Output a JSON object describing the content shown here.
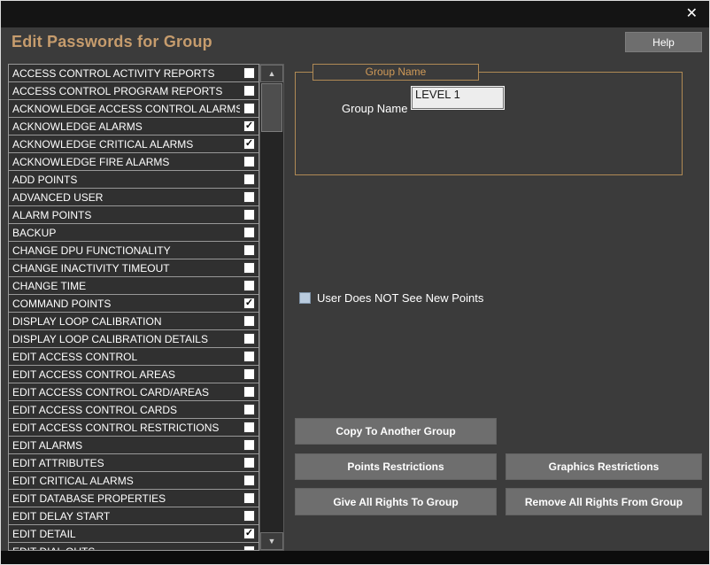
{
  "window": {
    "close_glyph": "✕"
  },
  "header": {
    "title": "Edit Passwords for Group",
    "help_label": "Help"
  },
  "permissions": {
    "checkmark_glyph": "✓",
    "items": [
      {
        "label": "ACCESS CONTROL ACTIVITY REPORTS",
        "checked": false
      },
      {
        "label": "ACCESS CONTROL PROGRAM REPORTS",
        "checked": false
      },
      {
        "label": "ACKNOWLEDGE ACCESS CONTROL ALARMS",
        "checked": false
      },
      {
        "label": "ACKNOWLEDGE ALARMS",
        "checked": true
      },
      {
        "label": "ACKNOWLEDGE CRITICAL ALARMS",
        "checked": true
      },
      {
        "label": "ACKNOWLEDGE FIRE ALARMS",
        "checked": false
      },
      {
        "label": "ADD POINTS",
        "checked": false
      },
      {
        "label": "ADVANCED USER",
        "checked": false
      },
      {
        "label": "ALARM POINTS",
        "checked": false
      },
      {
        "label": "BACKUP",
        "checked": false
      },
      {
        "label": "CHANGE DPU FUNCTIONALITY",
        "checked": false
      },
      {
        "label": "CHANGE INACTIVITY TIMEOUT",
        "checked": false
      },
      {
        "label": "CHANGE TIME",
        "checked": false
      },
      {
        "label": "COMMAND POINTS",
        "checked": true
      },
      {
        "label": "DISPLAY LOOP CALIBRATION",
        "checked": false
      },
      {
        "label": "DISPLAY LOOP CALIBRATION DETAILS",
        "checked": false
      },
      {
        "label": "EDIT ACCESS CONTROL",
        "checked": false
      },
      {
        "label": "EDIT ACCESS CONTROL AREAS",
        "checked": false
      },
      {
        "label": "EDIT ACCESS CONTROL CARD/AREAS",
        "checked": false
      },
      {
        "label": "EDIT ACCESS CONTROL CARDS",
        "checked": false
      },
      {
        "label": "EDIT ACCESS CONTROL RESTRICTIONS",
        "checked": false
      },
      {
        "label": "EDIT ALARMS",
        "checked": false
      },
      {
        "label": "EDIT ATTRIBUTES",
        "checked": false
      },
      {
        "label": "EDIT CRITICAL ALARMS",
        "checked": false
      },
      {
        "label": "EDIT DATABASE PROPERTIES",
        "checked": false
      },
      {
        "label": "EDIT DELAY START",
        "checked": false
      },
      {
        "label": "EDIT DETAIL",
        "checked": true
      },
      {
        "label": "EDIT DIAL OUTS",
        "checked": false
      }
    ]
  },
  "scrollbar": {
    "up_glyph": "▲",
    "down_glyph": "▼"
  },
  "group_box": {
    "title": "Group Name",
    "field_label": "Group Name",
    "field_value": "LEVEL 1"
  },
  "options": {
    "new_points_label": "User Does NOT See New Points",
    "new_points_checked": false
  },
  "buttons": {
    "copy": "Copy To Another Group",
    "points": "Points Restrictions",
    "graphics": "Graphics Restrictions",
    "give_all": "Give All Rights To Group",
    "remove_all": "Remove All Rights From Group"
  },
  "colors": {
    "background": "#3b3b3b",
    "titlebar": "#141414",
    "accent_tan": "#c69c6d",
    "groupbox_border": "#b08a55",
    "button_gray": "#6e6e6e",
    "list_background": "#303030",
    "new_points_checkbox": "#b9cbde"
  }
}
